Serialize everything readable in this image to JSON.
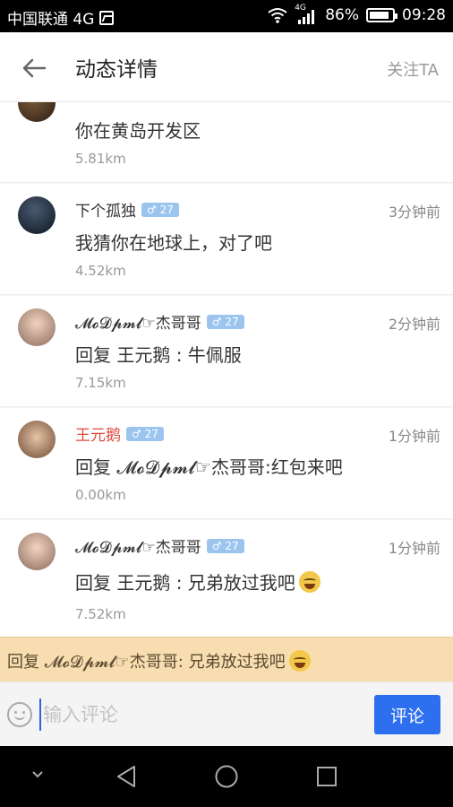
{
  "status_bar": {
    "carrier": "中国联通 4G",
    "network": "4G",
    "battery": "86%",
    "battery_level": 0.86,
    "time": "09:28"
  },
  "header": {
    "title": "动态详情",
    "follow_label": "关注TA"
  },
  "comments": [
    {
      "name": "",
      "badge": "",
      "text": "你在黄岛开发区",
      "distance": "5.81km",
      "time": ""
    },
    {
      "name": "下个孤独",
      "badge": "♂ 27",
      "text": "我猜你在地球上，对了吧",
      "distance": "4.52km",
      "time": "3分钟前"
    },
    {
      "name": "𝓜𝓸𝓓𝓹𝓶𝓵☞杰哥哥",
      "badge": "♂ 27",
      "text": "回复 王元鹅 : 牛佩服",
      "distance": "7.15km",
      "time": "2分钟前"
    },
    {
      "name": "王元鹅",
      "badge": "♂ 27",
      "text": "回复 𝓜𝓸𝓓𝓹𝓶𝓵☞杰哥哥:红包来吧",
      "distance": "0.00km",
      "time": "1分钟前"
    },
    {
      "name": "𝓜𝓸𝓓𝓹𝓶𝓵☞杰哥哥",
      "badge": "♂ 27",
      "text": "回复 王元鹅 : 兄弟放过我吧",
      "distance": "7.52km",
      "time": "1分钟前"
    }
  ],
  "reply_target": "回复 𝓜𝓸𝓓𝓹𝓶𝓵☞杰哥哥: 兄弟放过我吧",
  "input": {
    "placeholder": "输入评论",
    "value": "",
    "submit_label": "评论"
  },
  "colors": {
    "accent": "#2e6ff0",
    "reply_bar": "#f8ddb0",
    "highlight_name": "#e0483d",
    "badge": "#9bc4ef"
  }
}
